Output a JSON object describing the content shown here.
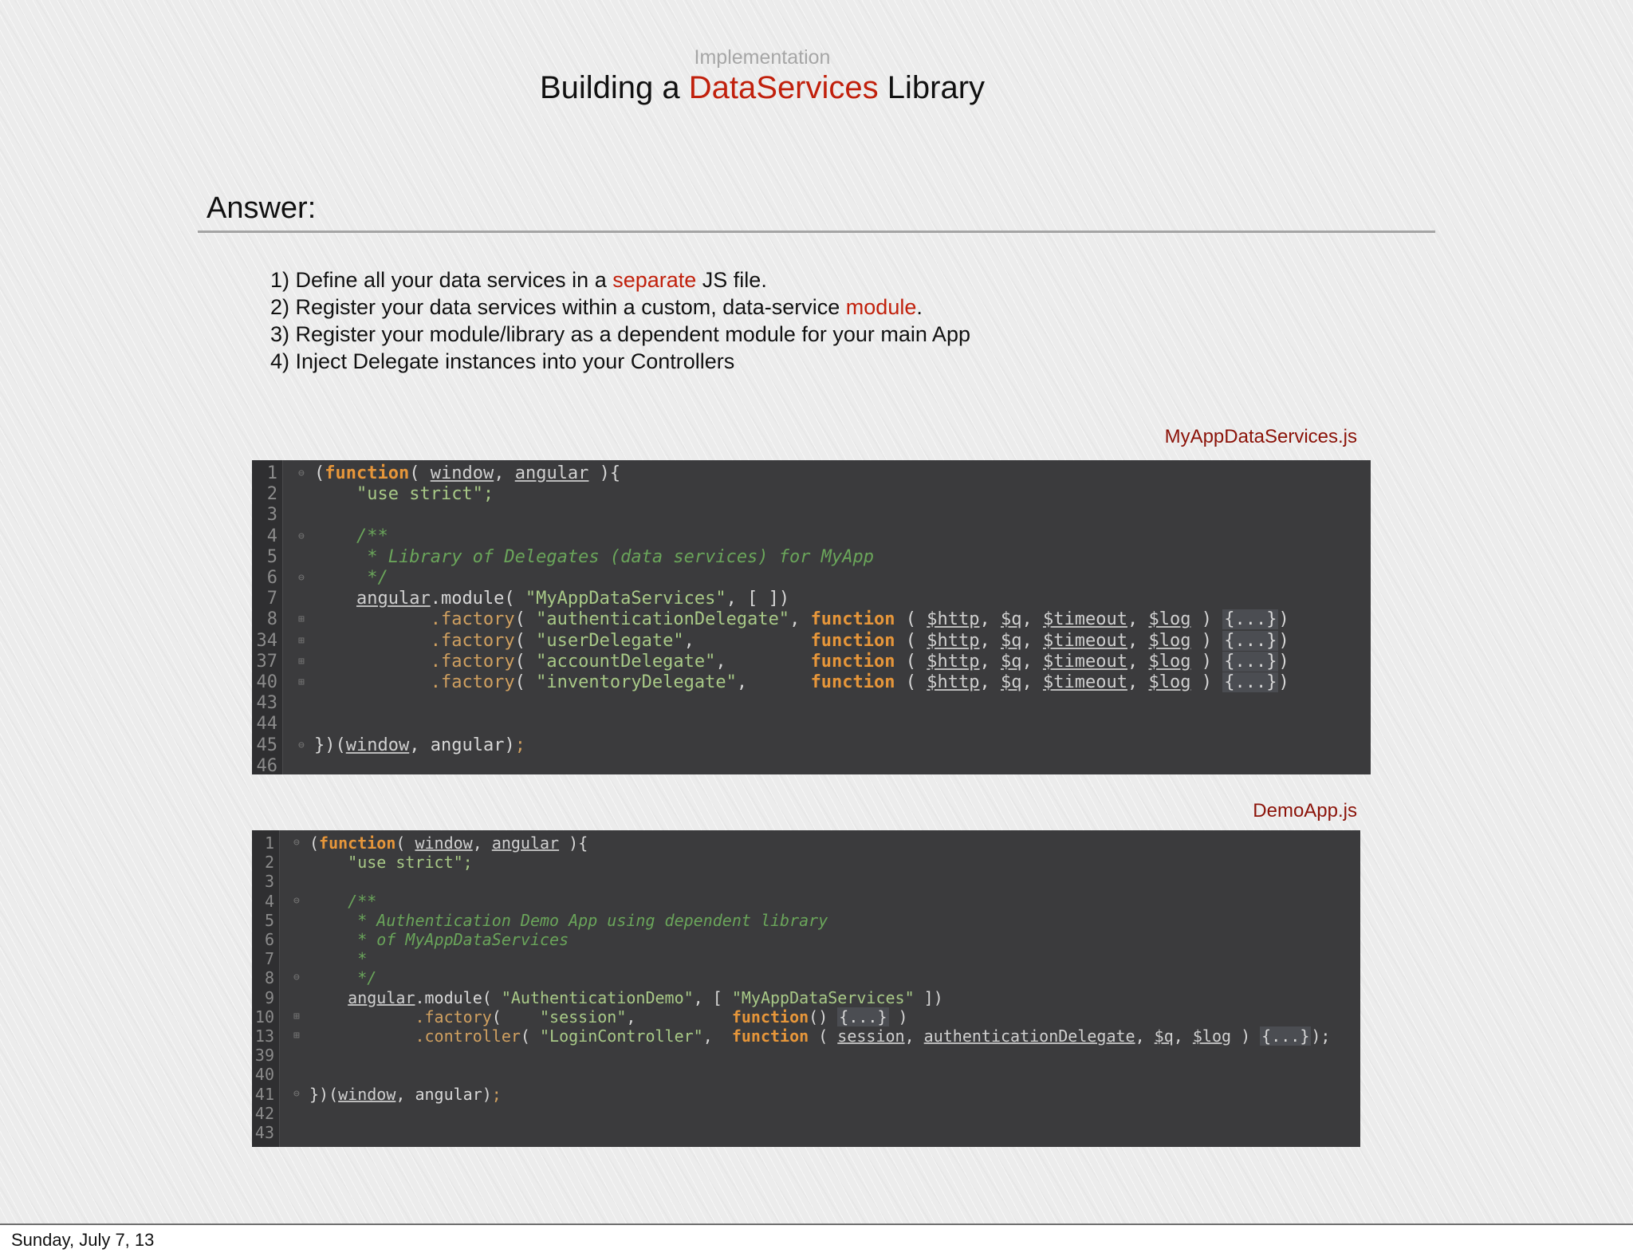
{
  "slide": {
    "section_label": "Implementation",
    "title": {
      "before": "Building a ",
      "highlight": "DataServices",
      "after": " Library"
    },
    "subhead": "Answer:",
    "steps": [
      {
        "before": "1) Define all your data services in a ",
        "highlight": "separate",
        "after": " JS file."
      },
      {
        "before": "2) Register your data services within a custom, data-service ",
        "highlight": "module",
        "after": "."
      },
      {
        "before": "3) Register your module/library as a dependent module for your main App",
        "highlight": "",
        "after": ""
      },
      {
        "before": "4) Inject Delegate instances into your Controllers",
        "highlight": "",
        "after": ""
      }
    ]
  },
  "code_blocks": [
    {
      "filename": "MyAppDataServices.js",
      "lines": [
        {
          "n": "1",
          "fold": "⊖",
          "tokens": [
            [
              "kw-paren",
              "("
            ],
            [
              "kw",
              "function"
            ],
            [
              "pl",
              "( "
            ],
            [
              "ul",
              "window"
            ],
            [
              "pl",
              ", "
            ],
            [
              "ul",
              "angular"
            ],
            [
              "pl",
              " ){"
            ]
          ]
        },
        {
          "n": "2",
          "fold": "",
          "tokens": [
            [
              "pl",
              "    "
            ],
            [
              "str",
              "\"use strict\";"
            ]
          ]
        },
        {
          "n": "3",
          "fold": "",
          "tokens": []
        },
        {
          "n": "4",
          "fold": "⊖",
          "tokens": [
            [
              "pl",
              "    "
            ],
            [
              "cmt",
              "/**"
            ]
          ]
        },
        {
          "n": "5",
          "fold": "",
          "tokens": [
            [
              "pl",
              "     "
            ],
            [
              "cmt",
              "* Library of Delegates (data services) for MyApp"
            ]
          ]
        },
        {
          "n": "6",
          "fold": "⊖",
          "tokens": [
            [
              "pl",
              "     "
            ],
            [
              "cmt",
              "*/"
            ]
          ]
        },
        {
          "n": "7",
          "fold": "",
          "tokens": [
            [
              "pl",
              "    "
            ],
            [
              "ul",
              "angular"
            ],
            [
              "pl",
              ".module( "
            ],
            [
              "str",
              "\"MyAppDataServices\""
            ],
            [
              "pl",
              ", [ ])"
            ]
          ]
        },
        {
          "n": "8",
          "fold": "⊞",
          "tokens": [
            [
              "pl",
              "           "
            ],
            [
              "fn",
              ".factory"
            ],
            [
              "pl",
              "( "
            ],
            [
              "str",
              "\"authenticationDelegate\""
            ],
            [
              "pl",
              ", "
            ],
            [
              "kw",
              "function"
            ],
            [
              "pl",
              " ( "
            ],
            [
              "ul",
              "$http"
            ],
            [
              "pl",
              ", "
            ],
            [
              "ul",
              "$q"
            ],
            [
              "pl",
              ", "
            ],
            [
              "ul",
              "$timeout"
            ],
            [
              "pl",
              ", "
            ],
            [
              "ul",
              "$log"
            ],
            [
              "pl",
              " ) "
            ],
            [
              "box",
              "{...}"
            ],
            [
              "pl",
              ")"
            ]
          ]
        },
        {
          "n": "34",
          "fold": "⊞",
          "tokens": [
            [
              "pl",
              "           "
            ],
            [
              "fn",
              ".factory"
            ],
            [
              "pl",
              "( "
            ],
            [
              "str",
              "\"userDelegate\""
            ],
            [
              "pl",
              ",           "
            ],
            [
              "kw",
              "function"
            ],
            [
              "pl",
              " ( "
            ],
            [
              "ul",
              "$http"
            ],
            [
              "pl",
              ", "
            ],
            [
              "ul",
              "$q"
            ],
            [
              "pl",
              ", "
            ],
            [
              "ul",
              "$timeout"
            ],
            [
              "pl",
              ", "
            ],
            [
              "ul",
              "$log"
            ],
            [
              "pl",
              " ) "
            ],
            [
              "box",
              "{...}"
            ],
            [
              "pl",
              ")"
            ]
          ]
        },
        {
          "n": "37",
          "fold": "⊞",
          "tokens": [
            [
              "pl",
              "           "
            ],
            [
              "fn",
              ".factory"
            ],
            [
              "pl",
              "( "
            ],
            [
              "str",
              "\"accountDelegate\""
            ],
            [
              "pl",
              ",        "
            ],
            [
              "kw",
              "function"
            ],
            [
              "pl",
              " ( "
            ],
            [
              "ul",
              "$http"
            ],
            [
              "pl",
              ", "
            ],
            [
              "ul",
              "$q"
            ],
            [
              "pl",
              ", "
            ],
            [
              "ul",
              "$timeout"
            ],
            [
              "pl",
              ", "
            ],
            [
              "ul",
              "$log"
            ],
            [
              "pl",
              " ) "
            ],
            [
              "box",
              "{...}"
            ],
            [
              "pl",
              ")"
            ]
          ]
        },
        {
          "n": "40",
          "fold": "⊞",
          "tokens": [
            [
              "pl",
              "           "
            ],
            [
              "fn",
              ".factory"
            ],
            [
              "pl",
              "( "
            ],
            [
              "str",
              "\"inventoryDelegate\""
            ],
            [
              "pl",
              ",      "
            ],
            [
              "kw",
              "function"
            ],
            [
              "pl",
              " ( "
            ],
            [
              "ul",
              "$http"
            ],
            [
              "pl",
              ", "
            ],
            [
              "ul",
              "$q"
            ],
            [
              "pl",
              ", "
            ],
            [
              "ul",
              "$timeout"
            ],
            [
              "pl",
              ", "
            ],
            [
              "ul",
              "$log"
            ],
            [
              "pl",
              " ) "
            ],
            [
              "box",
              "{...}"
            ],
            [
              "pl",
              ")"
            ]
          ]
        },
        {
          "n": "43",
          "fold": "",
          "tokens": []
        },
        {
          "n": "44",
          "fold": "",
          "tokens": []
        },
        {
          "n": "45",
          "fold": "⊖",
          "tokens": [
            [
              "pl",
              "})("
            ],
            [
              "ul",
              "window"
            ],
            [
              "pl",
              ", angular)"
            ],
            [
              "fn",
              ";"
            ]
          ]
        },
        {
          "n": "46",
          "fold": "",
          "tokens": []
        }
      ]
    },
    {
      "filename": "DemoApp.js",
      "lines": [
        {
          "n": "1",
          "fold": "⊖",
          "tokens": [
            [
              "pl",
              "("
            ],
            [
              "kw",
              "function"
            ],
            [
              "pl",
              "( "
            ],
            [
              "ul",
              "window"
            ],
            [
              "pl",
              ", "
            ],
            [
              "ul",
              "angular"
            ],
            [
              "pl",
              " ){"
            ]
          ]
        },
        {
          "n": "2",
          "fold": "",
          "tokens": [
            [
              "pl",
              "    "
            ],
            [
              "str",
              "\"use strict\";"
            ]
          ]
        },
        {
          "n": "3",
          "fold": "",
          "tokens": []
        },
        {
          "n": "4",
          "fold": "⊖",
          "tokens": [
            [
              "pl",
              "    "
            ],
            [
              "cmt",
              "/**"
            ]
          ]
        },
        {
          "n": "5",
          "fold": "",
          "tokens": [
            [
              "pl",
              "     "
            ],
            [
              "cmt",
              "* Authentication Demo App using dependent library"
            ]
          ]
        },
        {
          "n": "6",
          "fold": "",
          "tokens": [
            [
              "pl",
              "     "
            ],
            [
              "cmt",
              "* of MyAppDataServices"
            ]
          ]
        },
        {
          "n": "7",
          "fold": "",
          "tokens": [
            [
              "pl",
              "     "
            ],
            [
              "cmt",
              "*"
            ]
          ]
        },
        {
          "n": "8",
          "fold": "⊖",
          "tokens": [
            [
              "pl",
              "     "
            ],
            [
              "cmt",
              "*/"
            ]
          ]
        },
        {
          "n": "9",
          "fold": "",
          "tokens": [
            [
              "pl",
              "    "
            ],
            [
              "ul",
              "angular"
            ],
            [
              "pl",
              ".module( "
            ],
            [
              "str",
              "\"AuthenticationDemo\""
            ],
            [
              "pl",
              ", [ "
            ],
            [
              "str",
              "\"MyAppDataServices\""
            ],
            [
              "pl",
              " ])"
            ]
          ]
        },
        {
          "n": "10",
          "fold": "⊞",
          "tokens": [
            [
              "pl",
              "           "
            ],
            [
              "fn",
              ".factory"
            ],
            [
              "pl",
              "(    "
            ],
            [
              "str",
              "\"session\""
            ],
            [
              "pl",
              ",          "
            ],
            [
              "kw",
              "function"
            ],
            [
              "pl",
              "() "
            ],
            [
              "box",
              "{...}"
            ],
            [
              "pl",
              " )"
            ]
          ]
        },
        {
          "n": "13",
          "fold": "⊞",
          "tokens": [
            [
              "pl",
              "           "
            ],
            [
              "fn",
              ".controller"
            ],
            [
              "pl",
              "( "
            ],
            [
              "str",
              "\"LoginController\""
            ],
            [
              "pl",
              ",  "
            ],
            [
              "kw",
              "function"
            ],
            [
              "pl",
              " ( "
            ],
            [
              "ul",
              "session"
            ],
            [
              "pl",
              ", "
            ],
            [
              "ul",
              "authenticationDelegate"
            ],
            [
              "pl",
              ", "
            ],
            [
              "ul",
              "$q"
            ],
            [
              "pl",
              ", "
            ],
            [
              "ul",
              "$log"
            ],
            [
              "pl",
              " ) "
            ],
            [
              "box",
              "{...}"
            ],
            [
              "pl",
              ");"
            ]
          ]
        },
        {
          "n": "39",
          "fold": "",
          "tokens": []
        },
        {
          "n": "40",
          "fold": "",
          "tokens": []
        },
        {
          "n": "41",
          "fold": "⊖",
          "tokens": [
            [
              "pl",
              "})("
            ],
            [
              "ul",
              "window"
            ],
            [
              "pl",
              ", angular)"
            ],
            [
              "fn",
              ";"
            ]
          ]
        },
        {
          "n": "42",
          "fold": "",
          "tokens": []
        },
        {
          "n": "43",
          "fold": "",
          "tokens": []
        }
      ]
    }
  ],
  "footer": {
    "date": "Sunday, July 7, 13"
  }
}
